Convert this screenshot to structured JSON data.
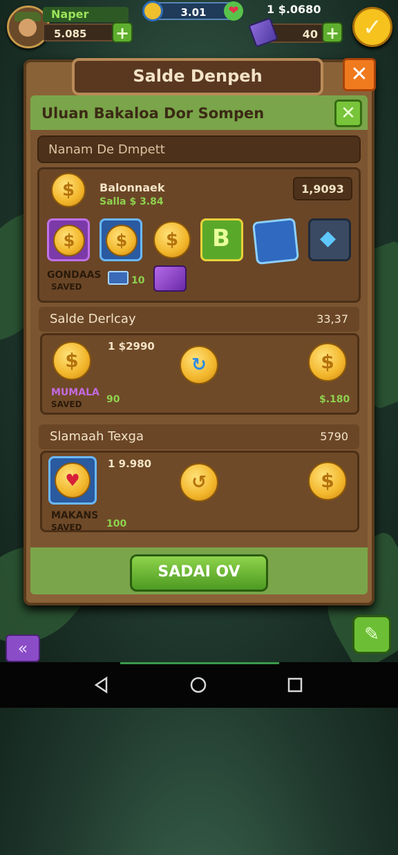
{
  "hud": {
    "player_name": "Naper",
    "player_value": "5.085",
    "coin_count": "3.01",
    "gem_total": "1 $.0680",
    "gem_value": "40"
  },
  "dialog": {
    "title": "Salde Denpeh",
    "subtitle": "Uluan Bakaloa Dor Sompen",
    "search_placeholder": "Nanam De Dmpett"
  },
  "balance_card": {
    "title": "Balonnaek",
    "subtitle": "Salla $ 3.84",
    "value": "1,9093",
    "slot_label": "GONDAAS",
    "slot_sublabel": "SAVED",
    "mini_value": "10"
  },
  "section_one": {
    "title": "Salde Derlcay",
    "value": "33,37",
    "amount": "1 $2990",
    "label": "MUMALA",
    "sublabel": "SAVED",
    "left_value": "90",
    "right_value": "$.180"
  },
  "section_two": {
    "title": "Slamaah Texga",
    "value": "5790",
    "amount": "1 9.980",
    "label": "MAKANS",
    "sublabel": "SAVED",
    "left_value": "100"
  },
  "action": {
    "button_label": "SADAI OV"
  },
  "colors": {
    "panel": "#8a6238",
    "accent_green": "#7aa54a",
    "close_orange": "#f07a1e",
    "gold": "#f2b52a"
  }
}
